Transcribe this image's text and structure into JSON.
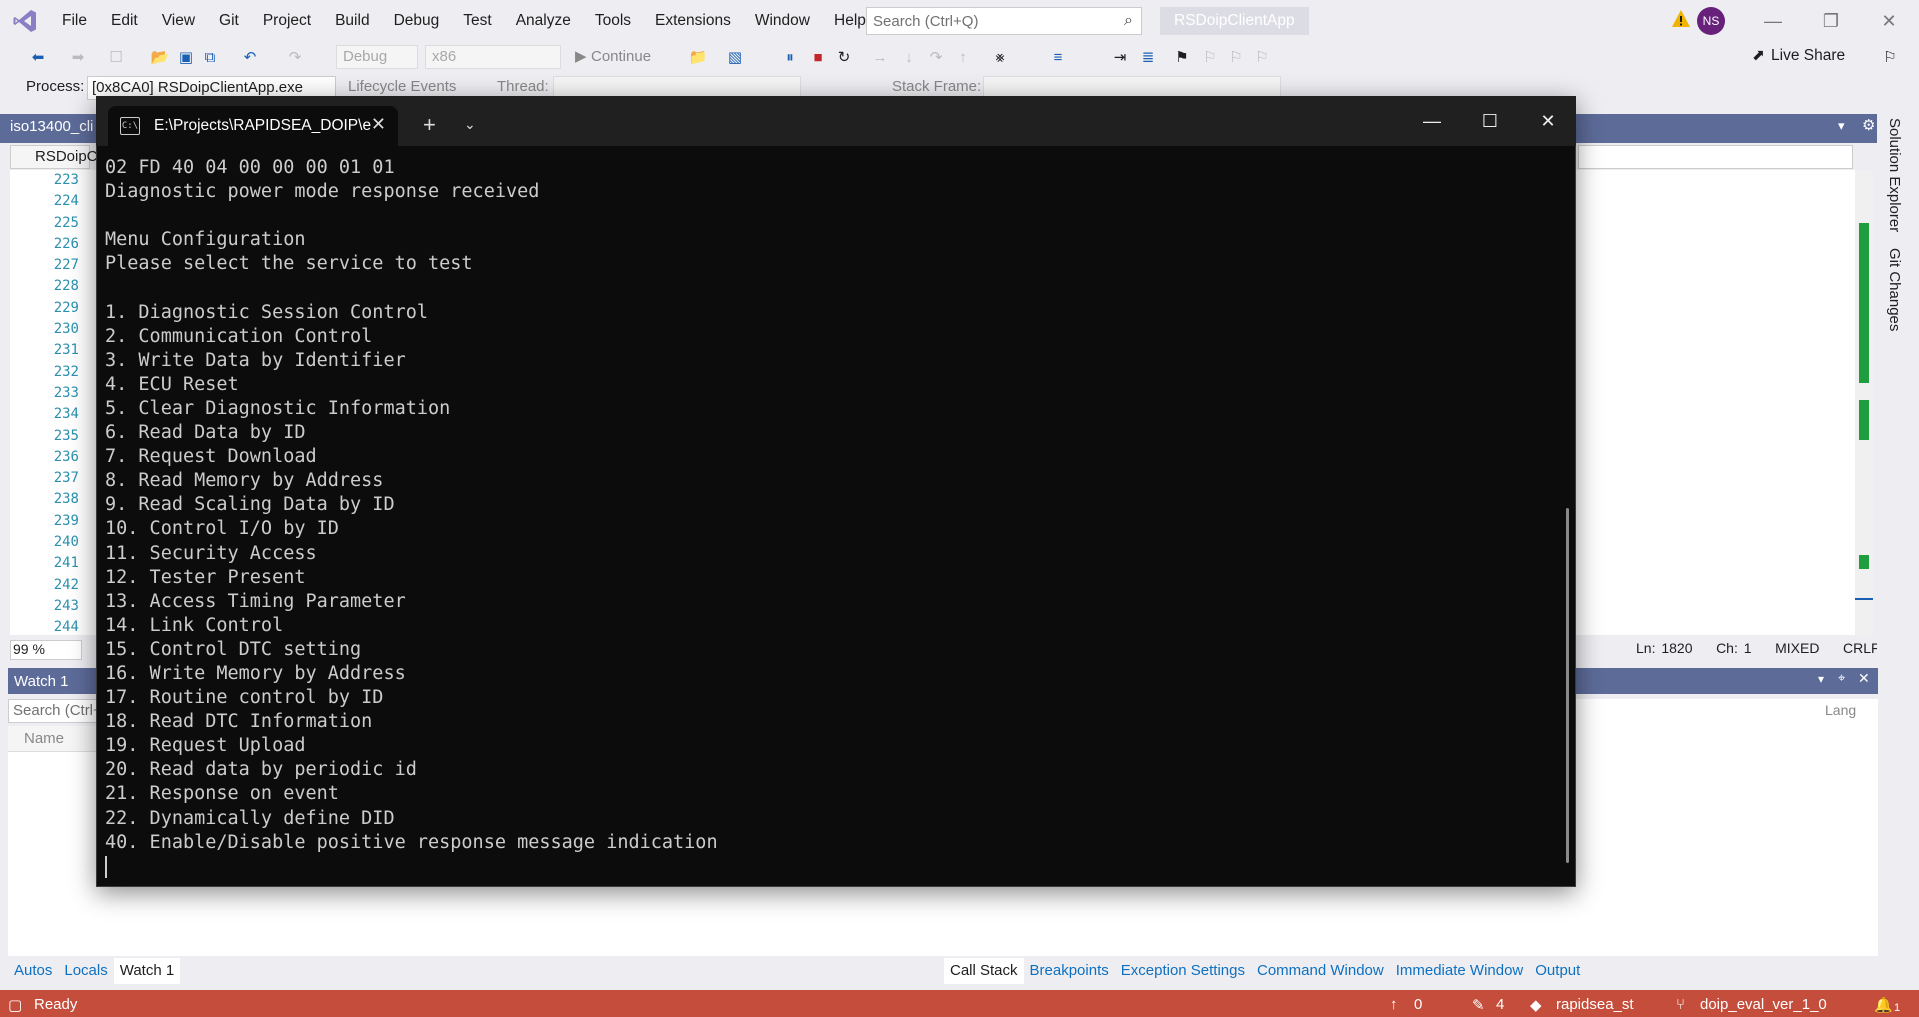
{
  "menubar": {
    "items": [
      "File",
      "Edit",
      "View",
      "Git",
      "Project",
      "Build",
      "Debug",
      "Test",
      "Analyze",
      "Tools",
      "Extensions",
      "Window",
      "Help"
    ],
    "search_placeholder": "Search (Ctrl+Q)",
    "app_title": "RSDoipClientApp",
    "avatar_initials": "NS"
  },
  "toolbar": {
    "config": "Debug",
    "platform": "x86",
    "continue_label": "Continue",
    "live_share": "Live Share"
  },
  "process_bar": {
    "process_label": "Process:",
    "process_value": "[0x8CA0] RSDoipClientApp.exe",
    "lifecycle_label": "Lifecycle Events",
    "thread_label": "Thread:",
    "stack_frame_label": "Stack Frame:"
  },
  "editor": {
    "tab_label": "iso13400_cli",
    "nav_label": "RSDoipC",
    "line_numbers": [
      "223",
      "224",
      "225",
      "226",
      "227",
      "228",
      "229",
      "230",
      "231",
      "232",
      "233",
      "234",
      "235",
      "236",
      "237",
      "238",
      "239",
      "240",
      "241",
      "242",
      "243",
      "244"
    ],
    "zoom": "99 %",
    "ln": "Ln: 1820",
    "ch": "Ch: 1",
    "mode": "MIXED",
    "eol": "CRLF"
  },
  "side_tabs": [
    "Solution Explorer",
    "Git Changes"
  ],
  "watch": {
    "title": "Watch 1",
    "search_placeholder": "Search (Ctrl+",
    "col_name": "Name",
    "lang_col": "Lang"
  },
  "bottom_tabs_left": [
    "Autos",
    "Locals",
    "Watch 1"
  ],
  "bottom_tabs_right": [
    "Call Stack",
    "Breakpoints",
    "Exception Settings",
    "Command Window",
    "Immediate Window",
    "Output"
  ],
  "statusbar": {
    "ready": "Ready",
    "push_count": "0",
    "pencil_count": "4",
    "repo": "rapidsea_st",
    "branch": "doip_eval_ver_1_0",
    "notif": "1"
  },
  "terminal": {
    "tab_title": "E:\\Projects\\RAPIDSEA_DOIP\\e",
    "lines": [
      "02 FD 40 04 00 00 00 01 01",
      "Diagnostic power mode response received",
      "",
      "Menu Configuration",
      "Please select the service to test",
      "",
      "1. Diagnostic Session Control",
      "2. Communication Control",
      "3. Write Data by Identifier",
      "4. ECU Reset",
      "5. Clear Diagnostic Information",
      "6. Read Data by ID",
      "7. Request Download",
      "8. Read Memory by Address",
      "9. Read Scaling Data by ID",
      "10. Control I/O by ID",
      "11. Security Access",
      "12. Tester Present",
      "13. Access Timing Parameter",
      "14. Link Control",
      "15. Control DTC setting",
      "16. Write Memory by Address",
      "17. Routine control by ID",
      "18. Read DTC Information",
      "19. Request Upload",
      "20. Read data by periodic id",
      "21. Response on event",
      "22. Dynamically define DID",
      "40. Enable/Disable positive response message indication"
    ]
  }
}
